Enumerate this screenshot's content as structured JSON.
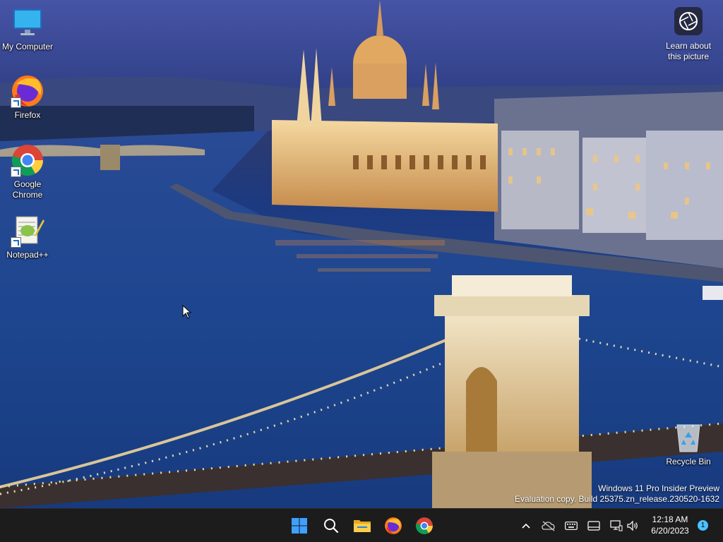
{
  "desktop": {
    "icons": [
      {
        "label": "My Computer"
      },
      {
        "label": "Firefox"
      },
      {
        "label": "Google\nChrome"
      },
      {
        "label": "Notepad++"
      },
      {
        "label": "Recycle Bin"
      }
    ],
    "learn_about": {
      "label": "Learn about\nthis picture"
    },
    "watermark": {
      "line1": "Windows 11 Pro Insider Preview",
      "line2": "Evaluation copy. Build 25375.zn_release.230520-1632"
    }
  },
  "taskbar": {
    "apps": [
      {
        "name": "start",
        "icon": "windows-logo-icon"
      },
      {
        "name": "search",
        "icon": "search-icon"
      },
      {
        "name": "file-explorer",
        "icon": "folder-icon"
      },
      {
        "name": "firefox",
        "icon": "firefox-icon"
      },
      {
        "name": "chrome",
        "icon": "chrome-icon"
      }
    ],
    "tray": {
      "icons": [
        "chevron-up-icon",
        "onedrive-offline-icon",
        "keyboard-icon",
        "tablet-icon",
        "network-icon",
        "volume-icon"
      ],
      "time": "12:18 AM",
      "date": "6/20/2023",
      "notification_count": "1"
    }
  },
  "colors": {
    "taskbar_bg": "#1c1c1c",
    "accent": "#4cc2ff",
    "river": "#1e4490"
  }
}
